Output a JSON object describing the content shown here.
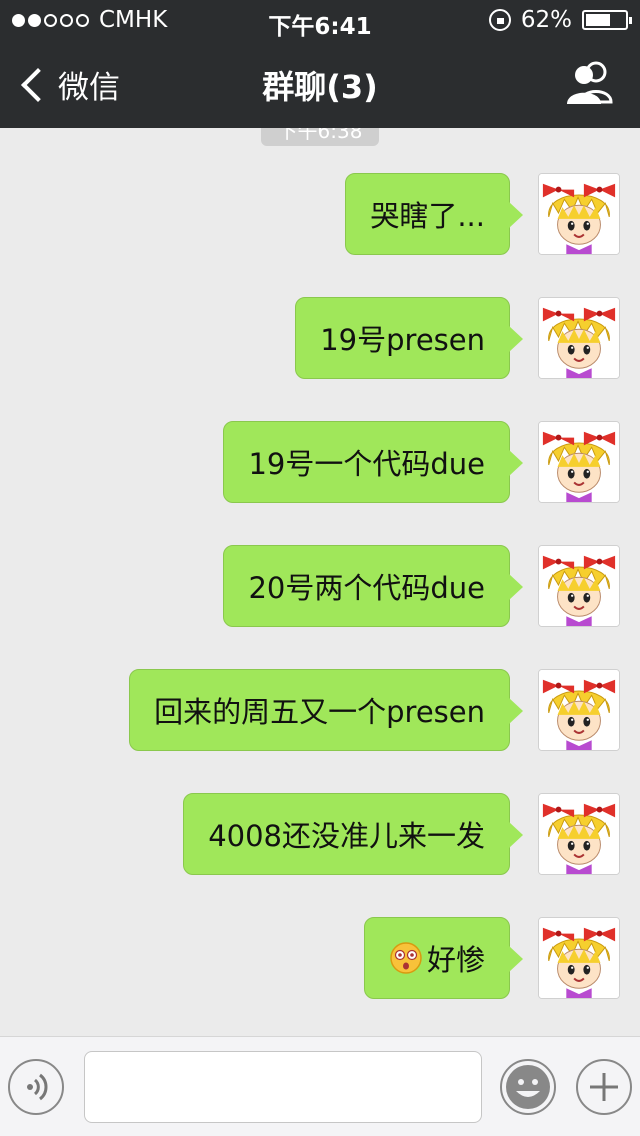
{
  "status": {
    "carrier": "CMHK",
    "time": "下午6:41",
    "battery": "62%",
    "battery_level": 0.62,
    "signal_bars": 2
  },
  "nav": {
    "back_label": "微信",
    "title": "群聊(3)"
  },
  "time_chip": "下午6:38",
  "messages": [
    {
      "text": "哭瞎了..."
    },
    {
      "text": "19号presen"
    },
    {
      "text": "19号一个代码due"
    },
    {
      "text": "20号两个代码due"
    },
    {
      "text": "回来的周五又一个presen"
    },
    {
      "text": "4008还没准儿来一发"
    },
    {
      "text": "好惨",
      "emoji": "dizzy-face-icon"
    }
  ],
  "colors": {
    "bubble": "#a0e75a",
    "bar": "#2b2d2f",
    "background": "#ebebeb"
  }
}
